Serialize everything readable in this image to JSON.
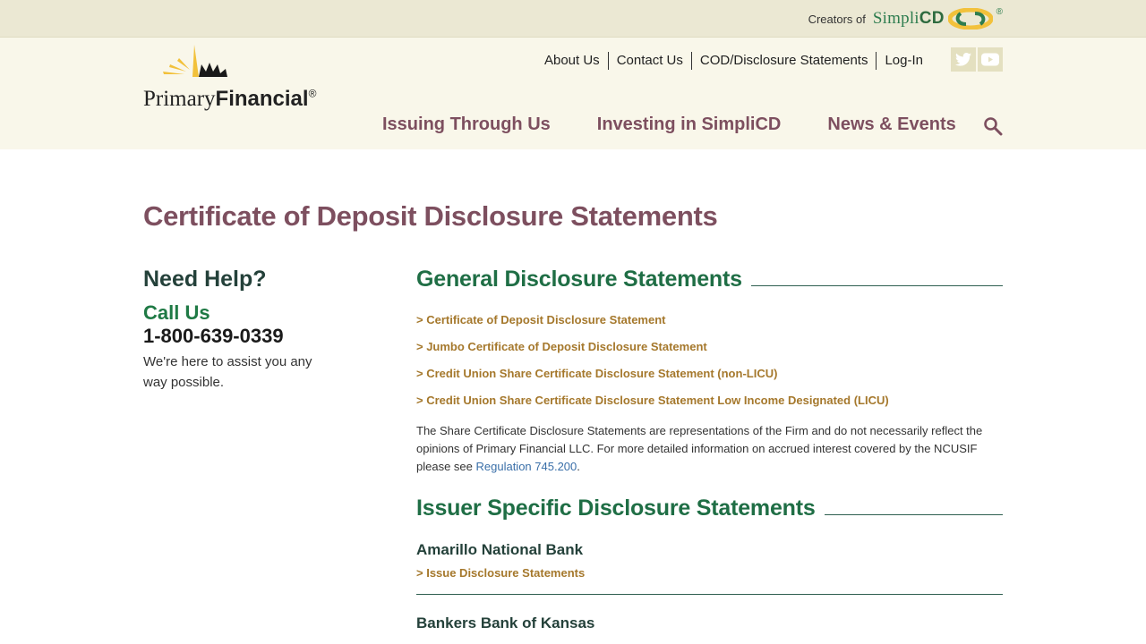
{
  "topbar": {
    "creators_label": "Creators of",
    "brand_simpli": "Simpli",
    "brand_cd": "CD",
    "brand_reg": "®"
  },
  "logo": {
    "primary": "Primary",
    "financial": "Financial",
    "reg": "®"
  },
  "utility_nav": {
    "about": "About Us",
    "contact": "Contact Us",
    "disclosures": "COD/Disclosure Statements",
    "login": "Log-In"
  },
  "social": {
    "twitter_icon": "twitter-icon",
    "youtube_icon": "youtube-icon"
  },
  "main_nav": {
    "issuing": "Issuing Through Us",
    "investing_prefix": "Investing in Simpli",
    "investing_suffix": "CD",
    "news": "News & Events"
  },
  "page": {
    "title": "Certificate of Deposit Disclosure Statements"
  },
  "sidebar": {
    "need_help": "Need Help?",
    "call_us": "Call Us",
    "phone": "1-800-639-0339",
    "assist": "We're here to assist you any way possible."
  },
  "general": {
    "heading": "General Disclosure Statements",
    "links": [
      "> Certificate of Deposit Disclosure Statement",
      "> Jumbo Certificate of Deposit Disclosure Statement",
      "> Credit Union Share Certificate Disclosure Statement (non-LICU)",
      "> Credit Union Share Certificate Disclosure Statement Low Income Designated (LICU)"
    ],
    "note_text": "The Share Certificate Disclosure Statements are representations of the Firm and do not necessarily reflect the opinions of Primary Financial LLC. For more detailed information on accrued interest covered by the NCUSIF please see ",
    "note_link": "Regulation 745.200",
    "note_end": "."
  },
  "issuer": {
    "heading": "Issuer Specific Disclosure Statements",
    "items": [
      {
        "name": "Amarillo National Bank",
        "link": "> Issue Disclosure Statements"
      },
      {
        "name": "Bankers Bank of Kansas"
      }
    ]
  },
  "colors": {
    "plum": "#7d4f5f",
    "green": "#1f6e45",
    "gold_link": "#a5782c",
    "topbar": "#ebe8d3",
    "header": "#f9f7ea"
  }
}
